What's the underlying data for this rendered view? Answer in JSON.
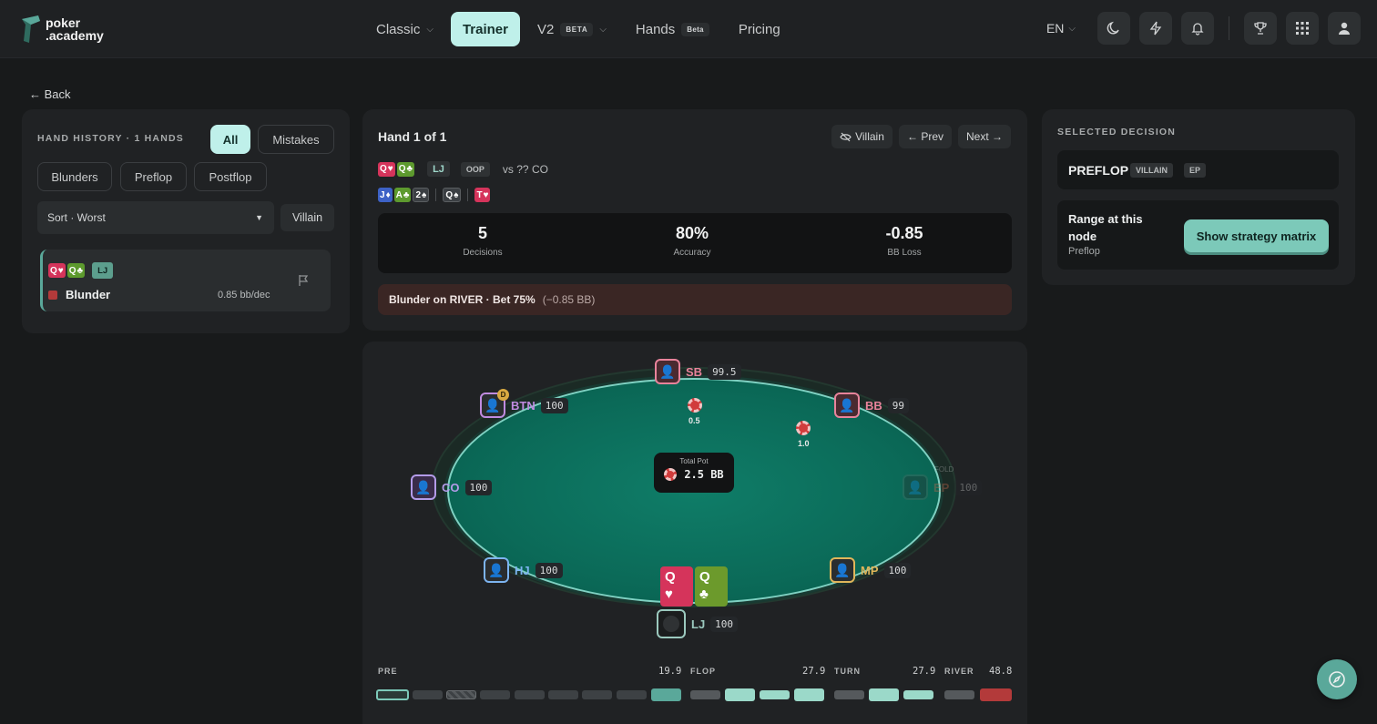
{
  "logo": {
    "line1": "poker",
    "line2": ".academy"
  },
  "nav": [
    {
      "label": "Classic",
      "chevron": true,
      "badge": ""
    },
    {
      "label": "Trainer",
      "active": true,
      "badge": ""
    },
    {
      "label": "V2",
      "badge": "BETA",
      "chevron": true
    },
    {
      "label": "Hands",
      "badge": "Beta"
    },
    {
      "label": "Pricing",
      "badge": ""
    }
  ],
  "header_right": {
    "lang": "EN",
    "icons": [
      "moon-icon",
      "lightning-icon",
      "bell-icon",
      "trophy-icon",
      "grid-icon",
      "user-icon"
    ]
  },
  "back_label": "← Back",
  "hand_history": {
    "title": "HAND HISTORY · 1 HANDS",
    "filters": [
      "All",
      "Mistakes",
      "Blunders",
      "Preflop",
      "Postflop"
    ],
    "active_filter": "All",
    "sort_value": "Sort · Worst",
    "villain_btn": "Villain",
    "item": {
      "cards": [
        {
          "rank": "Q",
          "suit": "♥"
        },
        {
          "rank": "Q",
          "suit": "♣"
        }
      ],
      "position": "LJ",
      "label": "Blunder",
      "loss": "0.85 bb/dec"
    }
  },
  "hand_summary": {
    "title": "Hand 1 of 1",
    "buttons": {
      "villain": "Villain",
      "prev": "← Prev",
      "next": "Next →"
    },
    "hero_cards": [
      {
        "rank": "Q",
        "suit": "♥"
      },
      {
        "rank": "Q",
        "suit": "♣"
      }
    ],
    "position": "LJ",
    "oop": "OOP",
    "vs_text": "vs ?? CO",
    "board": [
      {
        "rank": "J",
        "suit": "♦"
      },
      {
        "rank": "A",
        "suit": "♣"
      },
      {
        "rank": "2",
        "suit": "♠"
      },
      {
        "rank": "Q",
        "suit": "♠"
      },
      {
        "rank": "T",
        "suit": "♥"
      }
    ],
    "stats": [
      {
        "value": "5",
        "label": "Decisions"
      },
      {
        "value": "80%",
        "label": "Accuracy"
      },
      {
        "value": "-0.85",
        "label": "BB Loss"
      }
    ],
    "blunder_text": "Blunder on RIVER · Bet 75%",
    "blunder_loss": "(−0.85 BB)"
  },
  "selected_decision": {
    "title": "SELECTED DECISION",
    "street": "PREFLOP",
    "tags": [
      "VILLAIN",
      "EP"
    ],
    "range_label": "Range at this node",
    "range_sub": "Preflop",
    "button": "Show strategy matrix"
  },
  "table": {
    "seats": [
      {
        "pos": "SB",
        "stack": "99.5",
        "color": "#e8839b"
      },
      {
        "pos": "BTN",
        "stack": "100",
        "color": "#c08be0",
        "dealer": "D"
      },
      {
        "pos": "BB",
        "stack": "99",
        "color": "#e8839b"
      },
      {
        "pos": "CO",
        "stack": "100",
        "color": "#b39be8"
      },
      {
        "pos": "EP",
        "stack": "100",
        "color": "#4f6d66",
        "fold": "FOLD"
      },
      {
        "pos": "HJ",
        "stack": "100",
        "color": "#7db4f0"
      },
      {
        "pos": "MP",
        "stack": "100",
        "color": "#e0b55a"
      },
      {
        "pos": "LJ",
        "stack": "100",
        "color": "#9bc9be"
      }
    ],
    "bets": {
      "sb": "0.5",
      "bb": "1.0"
    },
    "pot_label": "Total Pot",
    "pot_value": "2.5 BB",
    "hero_cards": [
      {
        "rank": "Q",
        "suit": "♥"
      },
      {
        "rank": "Q",
        "suit": "♣"
      }
    ]
  },
  "timeline": {
    "streets": [
      {
        "label": "PRE",
        "amount": "19.9"
      },
      {
        "label": "FLOP",
        "amount": "27.9"
      },
      {
        "label": "TURN",
        "amount": "27.9"
      },
      {
        "label": "RIVER",
        "amount": "48.8"
      }
    ]
  }
}
